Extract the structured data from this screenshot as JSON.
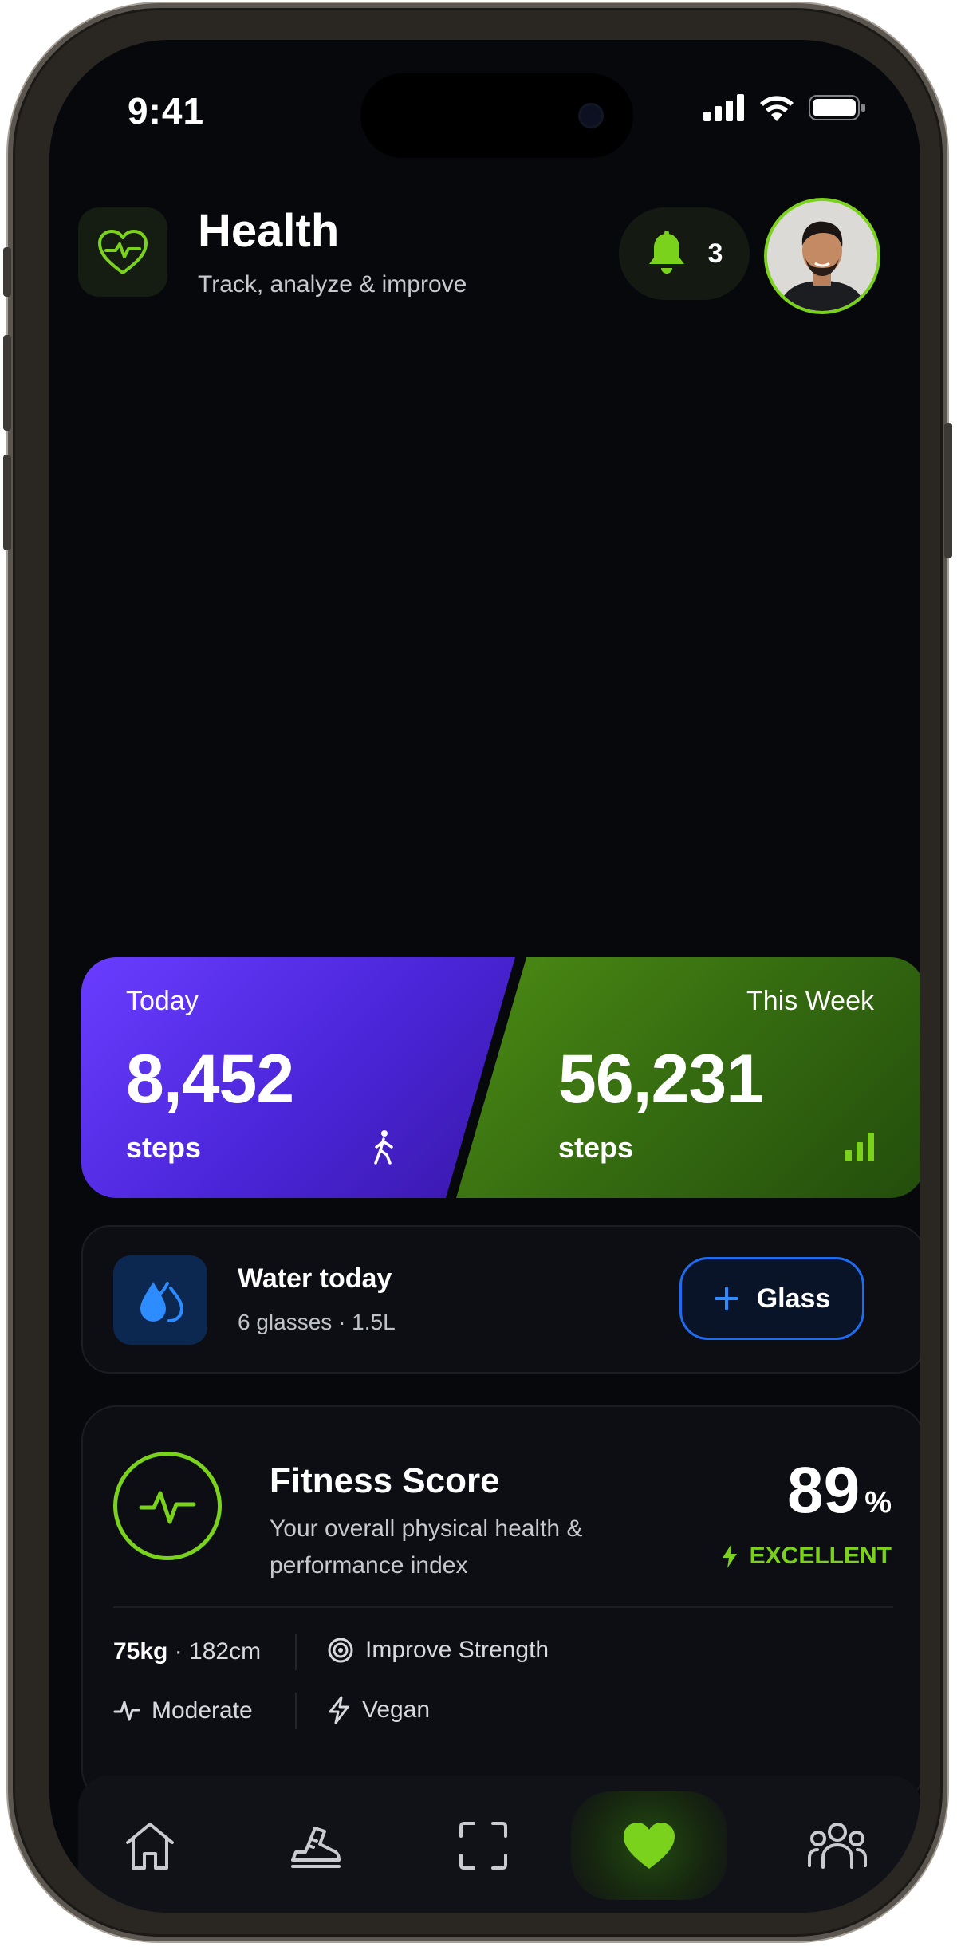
{
  "status_bar": {
    "time": "9:41"
  },
  "header": {
    "title": "Health",
    "subtitle": "Track, analyze & improve",
    "notification_count": "3"
  },
  "steps": {
    "today": {
      "label": "Today",
      "value": "8,452",
      "unit": "steps"
    },
    "week": {
      "label": "This Week",
      "value": "56,231",
      "unit": "steps"
    }
  },
  "water": {
    "title": "Water today",
    "subtitle": "6 glasses · 1.5L",
    "button_label": "Glass"
  },
  "fitness": {
    "title": "Fitness Score",
    "description": "Your overall physical health & performance index",
    "score": "89",
    "score_unit": "%",
    "rating": "EXCELLENT",
    "weight": "75kg",
    "height": "· 182cm",
    "goal": "Improve Strength",
    "activity": "Moderate",
    "diet": "Vegan"
  },
  "colors": {
    "accent_green": "#7ad21d",
    "today_purple": "#5a2ff0",
    "week_green": "#3a7412",
    "water_blue": "#1f6cf0"
  },
  "nav": {
    "items": [
      "home-icon",
      "sneaker-icon",
      "scan-icon",
      "heart-icon",
      "community-icon"
    ],
    "active": "heart-icon"
  }
}
